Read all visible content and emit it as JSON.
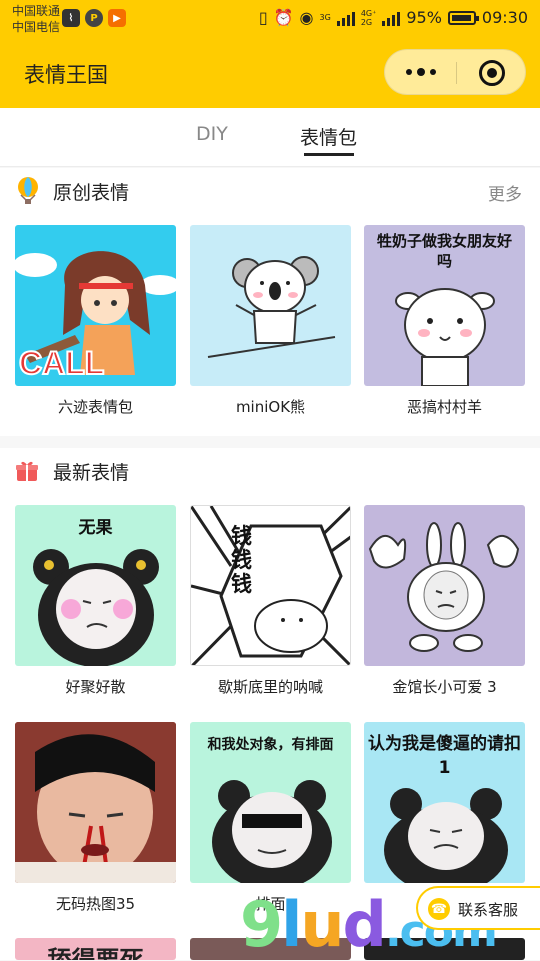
{
  "status_bar": {
    "carrier1": "中国联通",
    "carrier2": "中国电信",
    "app_icons": [
      "monitor-app-icon",
      "p-app-icon",
      "play-app-icon"
    ],
    "network1": "3G",
    "network2": "4G⁺",
    "network3": "2G",
    "battery": "95%",
    "battery_level": 0.95,
    "time": "09:30"
  },
  "header": {
    "title": "表情王国",
    "more_icon": "more-dots-icon",
    "close_icon": "mini-program-close-icon"
  },
  "tabs": [
    {
      "label": "DIY",
      "active": false
    },
    {
      "label": "表情包",
      "active": true
    }
  ],
  "section_original": {
    "icon": "hot-air-balloon-icon",
    "title": "原创表情",
    "more": "更多",
    "items": [
      {
        "caption": "六迹表情包",
        "thumb_text": "CALL"
      },
      {
        "caption": "miniOK熊",
        "thumb_text": ""
      },
      {
        "caption": "恶搞村村羊",
        "thumb_text": "牲奶子做我女朋友好吗"
      }
    ]
  },
  "section_latest": {
    "icon": "gift-icon",
    "title": "最新表情",
    "items": [
      {
        "caption": "好聚好散",
        "thumb_text": "无果"
      },
      {
        "caption": "歇斯底里的呐喊",
        "thumb_text": "钱钱钱"
      },
      {
        "caption": "金馆长小可爱 3",
        "thumb_text": ""
      },
      {
        "caption": "无码热图35",
        "thumb_text": ""
      },
      {
        "caption": "排面",
        "thumb_text": "和我处对象，有排面"
      },
      {
        "caption": "",
        "thumb_text": "认为我是傻逼的请扣1"
      }
    ],
    "partial_thumb_text": "舔得要死"
  },
  "customer_service": {
    "icon": "phone-icon",
    "label": "联系客服"
  },
  "watermark": {
    "g": "9",
    "l": "l",
    "u": "u",
    "d": "d",
    "com": ".com"
  },
  "colors": {
    "brand": "#ffcc00",
    "thumb_cyan": "#33ccee",
    "thumb_lightblue": "#c7ecf8",
    "thumb_lavender": "#c3bde0",
    "thumb_mint": "#b9f4dd",
    "thumb_lilac": "#c2b7dc"
  }
}
